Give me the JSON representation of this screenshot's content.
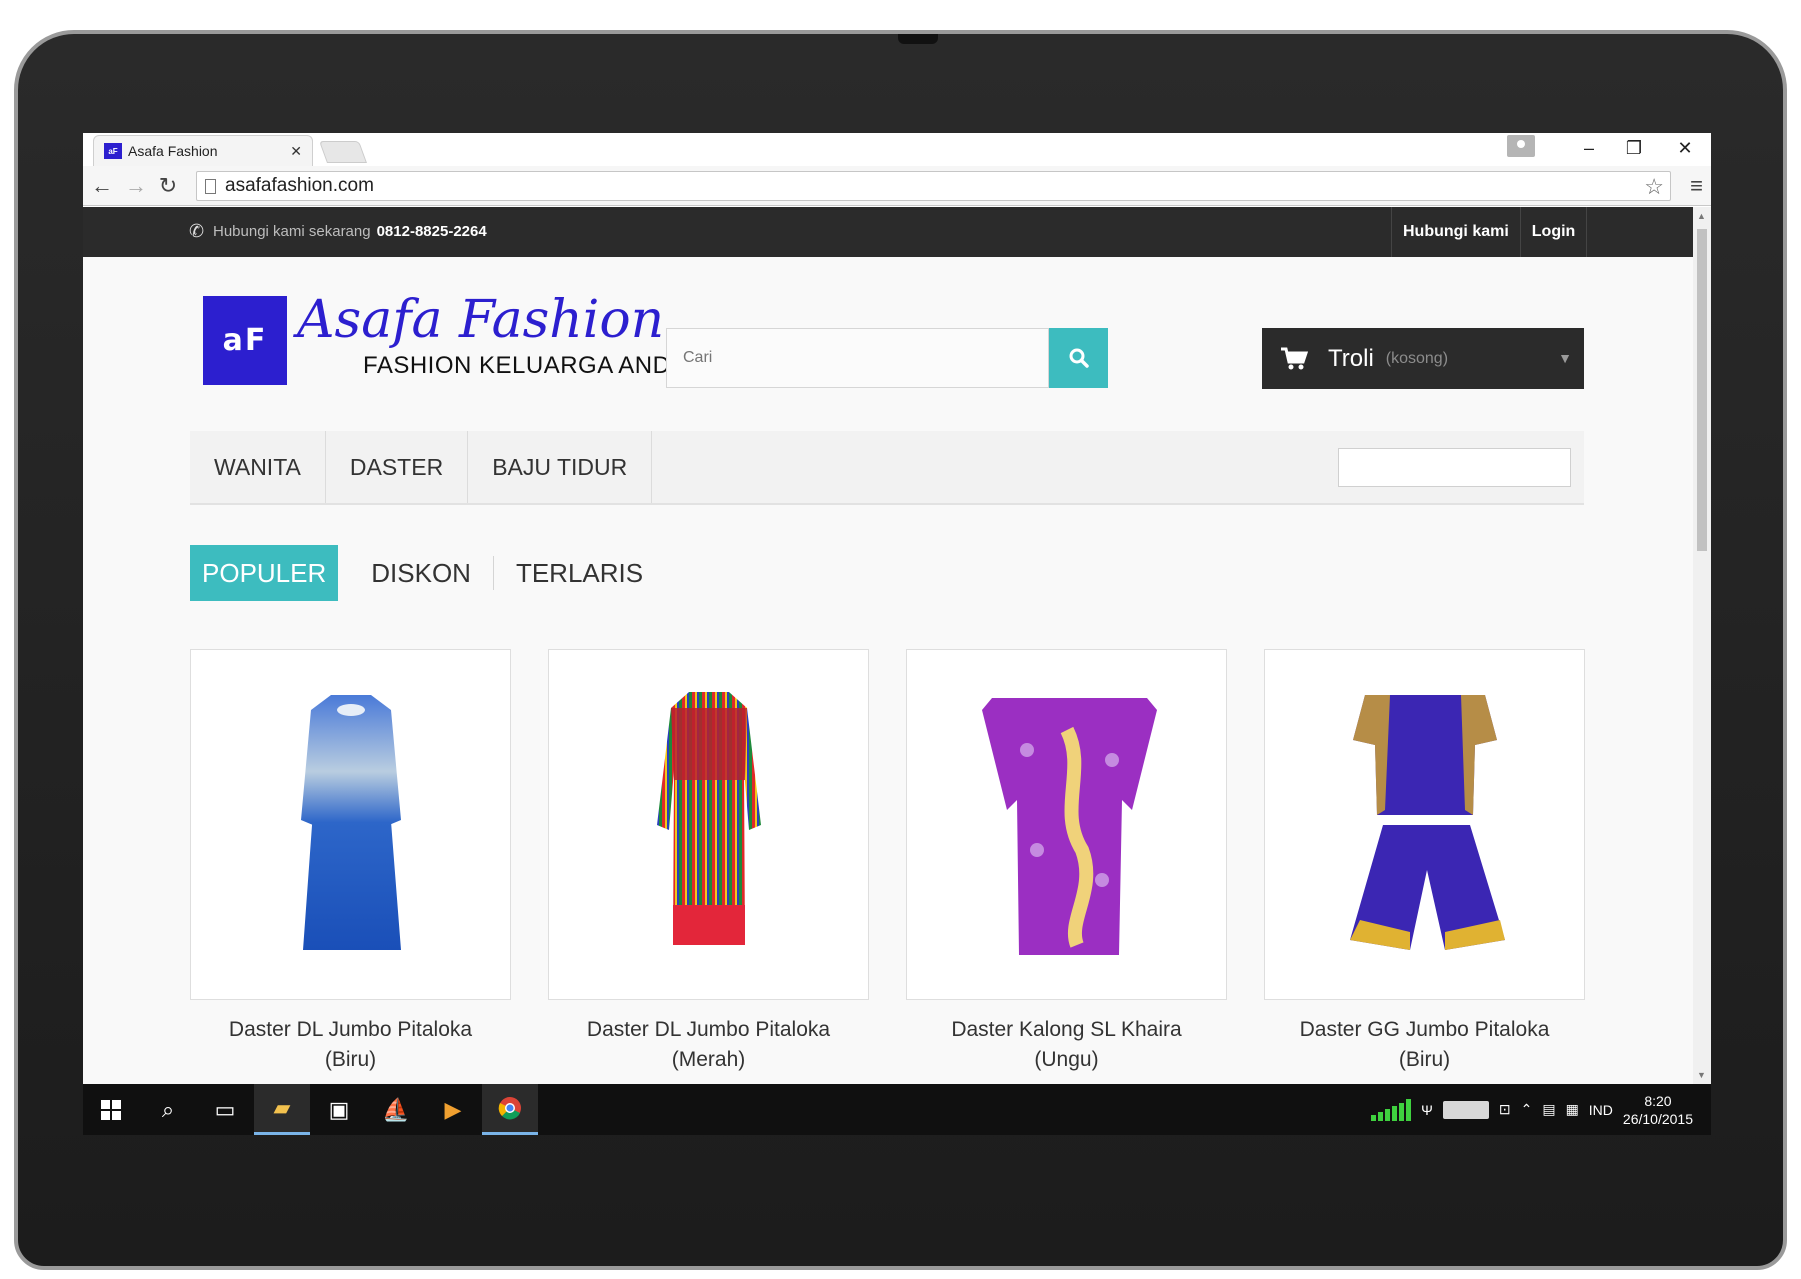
{
  "browser": {
    "tab_title": "Asafa Fashion",
    "favicon_text": "aF",
    "url": "asafafashion.com"
  },
  "topbar": {
    "contact_label": "Hubungi kami sekarang",
    "phone": "0812-8825-2264",
    "links": [
      "Hubungi kami",
      "Login"
    ]
  },
  "header": {
    "logo_mark": "aF",
    "logo_name": "Asafa Fashion",
    "logo_tagline": "FASHION KELUARGA ANDA",
    "search_placeholder": "Cari",
    "cart_label": "Troli",
    "cart_status": "(kosong)"
  },
  "nav": {
    "items": [
      "WANITA",
      "DASTER",
      "BAJU TIDUR"
    ]
  },
  "product_tabs": [
    "POPULER",
    "DISKON",
    "TERLARIS"
  ],
  "products": [
    {
      "name": "Daster DL Jumbo Pitaloka",
      "variant": "(Biru)"
    },
    {
      "name": "Daster DL Jumbo Pitaloka",
      "variant": "(Merah)"
    },
    {
      "name": "Daster Kalong SL Khaira",
      "variant": "(Ungu)"
    },
    {
      "name": "Daster GG Jumbo Pitaloka",
      "variant": "(Biru)"
    }
  ],
  "taskbar": {
    "language": "IND",
    "time": "8:20",
    "date": "26/10/2015"
  },
  "colors": {
    "brand": "#2c1fcf",
    "accent": "#3dbcbf",
    "dark": "#2b2b2b"
  }
}
